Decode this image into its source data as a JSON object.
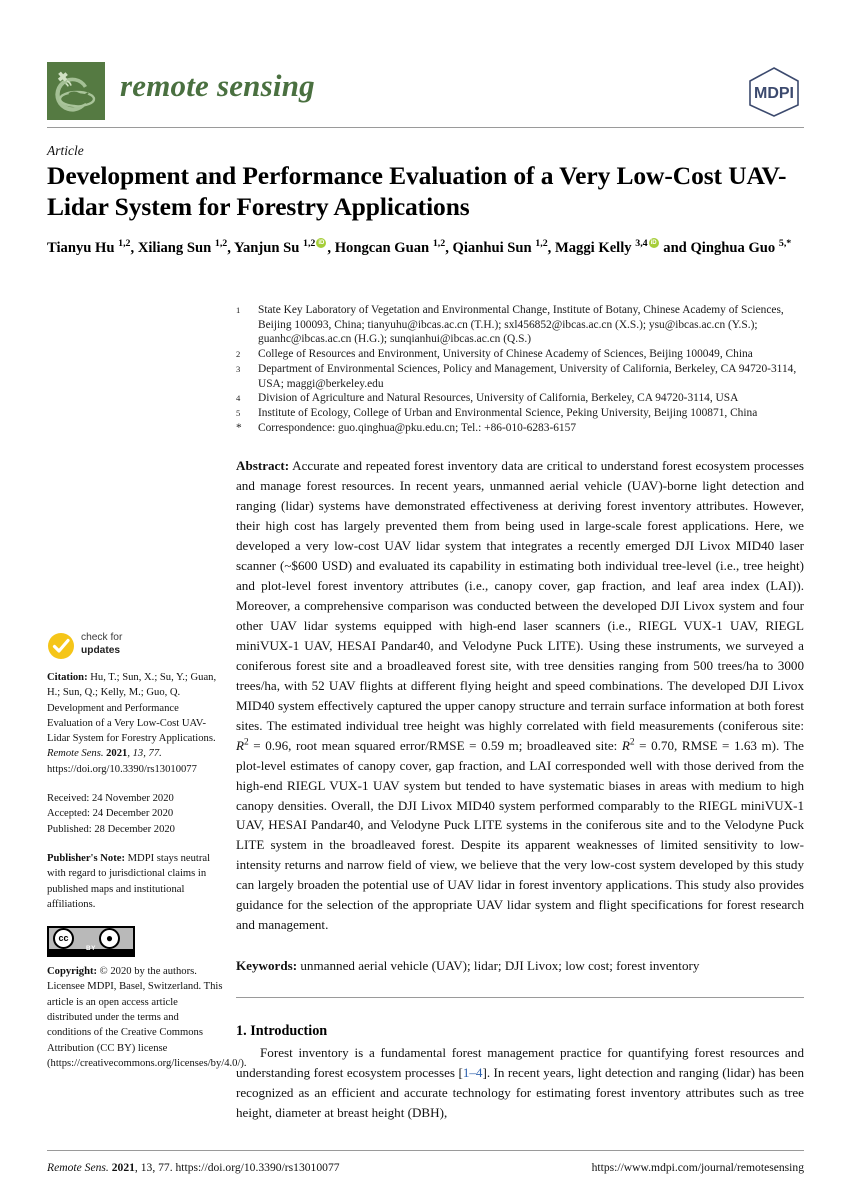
{
  "masthead": {
    "journal_name": "remote sensing",
    "journal_logo_icon": "satellite-globe-icon",
    "publisher_logo_text": "MDPI",
    "logo_green": "#557a42",
    "mdpi_navy": "#3c4a6e"
  },
  "article": {
    "type": "Article",
    "title": "Development and Performance Evaluation of a Very Low-Cost UAV-Lidar System for Forestry Applications"
  },
  "authors": {
    "line1_parts": [
      {
        "name": "Tianyu Hu",
        "sup": "1,2",
        "orcid": false,
        "sep": ", "
      },
      {
        "name": "Xiliang Sun",
        "sup": "1,2",
        "orcid": false,
        "sep": ", "
      },
      {
        "name": "Yanjun Su",
        "sup": "1,2",
        "orcid": true,
        "sep": ", "
      },
      {
        "name": "Hongcan Guan",
        "sup": "1,2",
        "orcid": false,
        "sep": ", "
      },
      {
        "name": "Qianhui Sun",
        "sup": "1,2",
        "orcid": false,
        "sep": ", "
      },
      {
        "name": "Maggi Kelly",
        "sup": "3,4",
        "orcid": true,
        "sep": " and "
      },
      {
        "name": "Qinghua Guo",
        "sup": "5,*",
        "orcid": false,
        "sep": ""
      }
    ]
  },
  "affiliations": [
    {
      "num": "1",
      "text": "State Key Laboratory of Vegetation and Environmental Change, Institute of Botany, Chinese Academy of Sciences, Beijing 100093, China; tianyuhu@ibcas.ac.cn (T.H.); sxl456852@ibcas.ac.cn (X.S.); ysu@ibcas.ac.cn (Y.S.); guanhc@ibcas.ac.cn (H.G.); sunqianhui@ibcas.ac.cn (Q.S.)"
    },
    {
      "num": "2",
      "text": "College of Resources and Environment, University of Chinese Academy of Sciences, Beijing 100049, China"
    },
    {
      "num": "3",
      "text": "Department of Environmental Sciences, Policy and Management, University of California, Berkeley, CA 94720-3114, USA; maggi@berkeley.edu"
    },
    {
      "num": "4",
      "text": "Division of Agriculture and Natural Resources, University of California, Berkeley, CA 94720-3114, USA"
    },
    {
      "num": "5",
      "text": "Institute of Ecology, College of Urban and Environmental Science, Peking University, Beijing 100871, China"
    },
    {
      "num": "*",
      "text": "Correspondence: guo.qinghua@pku.edu.cn; Tel.: +86-010-6283-6157"
    }
  ],
  "abstract": {
    "label": "Abstract:",
    "text_part1": " Accurate and repeated forest inventory data are critical to understand forest ecosystem processes and manage forest resources. In recent years, unmanned aerial vehicle (UAV)-borne light detection and ranging (lidar) systems have demonstrated effectiveness at deriving forest inventory attributes. However, their high cost has largely prevented them from being used in large-scale forest applications. Here, we developed a very low-cost UAV lidar system that integrates a recently emerged DJI Livox MID40 laser scanner (~$600 USD) and evaluated its capability in estimating both individual tree-level (i.e., tree height) and plot-level forest inventory attributes (i.e., canopy cover, gap fraction, and leaf area index (LAI)). Moreover, a comprehensive comparison was conducted between the developed DJI Livox system and four other UAV lidar systems equipped with high-end laser scanners (i.e., RIEGL VUX-1 UAV, RIEGL miniVUX-1 UAV, HESAI Pandar40, and Velodyne Puck LITE). Using these instruments, we surveyed a coniferous forest site and a broadleaved forest site, with tree densities ranging from 500 trees/ha to 3000 trees/ha, with 52 UAV flights at different flying height and speed combinations. The developed DJI Livox MID40 system effectively captured the upper canopy structure and terrain surface information at both forest sites. The estimated individual tree height was highly correlated with field measurements (coniferous site: ",
    "r2_a": "R",
    "r2_a_sup": "2",
    "text_part2": " = 0.96, root mean squared error/RMSE = 0.59 m; broadleaved site: ",
    "r2_b": "R",
    "r2_b_sup": "2",
    "text_part3": " = 0.70, RMSE = 1.63 m). The plot-level estimates of canopy cover, gap fraction, and LAI corresponded well with those derived from the high-end RIEGL VUX-1 UAV system but tended to have systematic biases in areas with medium to high canopy densities. Overall, the DJI Livox MID40 system performed comparably to the RIEGL miniVUX-1 UAV, HESAI Pandar40, and Velodyne Puck LITE systems in the coniferous site and to the Velodyne Puck LITE system in the broadleaved forest. Despite its apparent weaknesses of limited sensitivity to low-intensity returns and narrow field of view, we believe that the very low-cost system developed by this study can largely broaden the potential use of UAV lidar in forest inventory applications. This study also provides guidance for the selection of the appropriate UAV lidar system and flight specifications for forest research and management."
  },
  "keywords": {
    "label": "Keywords:",
    "text": " unmanned aerial vehicle (UAV); lidar; DJI Livox; low cost; forest inventory"
  },
  "introduction": {
    "heading": "1. Introduction",
    "para_a": "Forest inventory is a fundamental forest management practice for quantifying forest resources and understanding forest ecosystem processes [",
    "ref": "1–4",
    "para_b": "]. In recent years, light detection and ranging (lidar) has been recognized as an efficient and accurate technology for estimating forest inventory attributes such as tree height, diameter at breast height (DBH),"
  },
  "sidebar": {
    "check_updates_icon": "check-circle-icon",
    "check_updates_line1": "check for",
    "check_updates_line2": "updates",
    "check_updates_color": "#f5c518",
    "citation_label": "Citation:",
    "citation_text_a": " Hu, T.; Sun, X.; Su, Y.; Guan, H.; Sun, Q.; Kelly, M.; Guo, Q. Development and Performance Evaluation of a Very Low-Cost UAV-Lidar System for Forestry Applications. ",
    "citation_journal": "Remote Sens.",
    "citation_year": " 2021",
    "citation_vol": ", 13, 77.",
    "citation_doi": " https://doi.org/10.3390/rs13010077",
    "received": "Received: 24 November 2020",
    "accepted": "Accepted: 24 December 2020",
    "published": "Published: 28 December 2020",
    "publisher_note_label": "Publisher's Note:",
    "publisher_note_text": " MDPI stays neutral with regard to jurisdictional claims in published maps and institutional affiliations.",
    "cc_badge_icon": "creative-commons-by-icon",
    "cc_label": "BY",
    "cc_mark": "cc",
    "cc_person": "①",
    "copyright_label": "Copyright:",
    "copyright_text": " © 2020 by the authors. Licensee MDPI, Basel, Switzerland. This article is an open access article distributed under the terms and conditions of the Creative Commons Attribution (CC BY) license (https://creativecommons.org/licenses/by/4.0/)."
  },
  "footer": {
    "left_journal": "Remote Sens.",
    "left_year": " 2021",
    "left_rest": ", 13, 77. https://doi.org/10.3390/rs13010077",
    "right": "https://www.mdpi.com/journal/remotesensing"
  }
}
